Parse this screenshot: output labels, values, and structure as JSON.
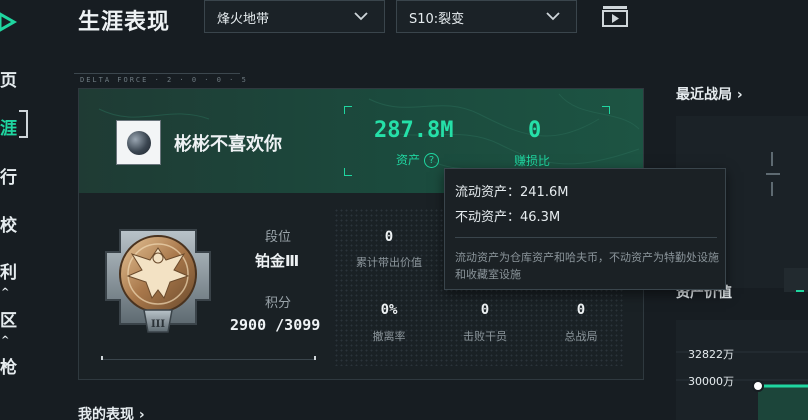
{
  "nav": {
    "items": [
      {
        "label": "页",
        "caret": ""
      },
      {
        "label": "涯",
        "caret": ""
      },
      {
        "label": "行",
        "caret": ""
      },
      {
        "label": "校",
        "caret": ""
      },
      {
        "label": "利",
        "caret": "^"
      },
      {
        "label": "区",
        "caret": "^"
      },
      {
        "label": "枪",
        "caret": ""
      }
    ],
    "active_index": 1
  },
  "header": {
    "title": "生涯表现",
    "map_select": "烽火地带",
    "season_select": "S10:裂变"
  },
  "profile": {
    "panel_label": "DELTA FORCE · 2 · 0 · 0 · 5",
    "username": "彬彬不喜欢你",
    "assets_value": "287.8M",
    "assets_label": "资产",
    "assets_help": "?",
    "profit_value": "0",
    "profit_label": "赚损比"
  },
  "rank": {
    "tier_label": "段位",
    "tier_value": "铂金Ⅲ",
    "score_label": "积分",
    "score_value": "2900 /3099",
    "badge_numeral": "III"
  },
  "stats": {
    "items": [
      {
        "value": "0",
        "label": "累计带出价值"
      },
      {
        "value": "0%",
        "label": "撤离率"
      },
      {
        "value": "0",
        "label": "击败干员"
      },
      {
        "value": "0",
        "label": "总战局"
      }
    ]
  },
  "tooltip": {
    "liquid": "流动资产：241.6M",
    "fixed": "不动资产：46.3M",
    "description": "流动资产为仓库资产和哈夫币，不动资产为特勤处设施和收藏室设施"
  },
  "right": {
    "recent_title": "最近战局",
    "asset_title": "资产价值",
    "tick_1": "32822万",
    "tick_2": "30000万",
    "chevron": "›"
  },
  "bottom": {
    "my_performance": "我的表现"
  },
  "colors": {
    "accent": "#1fd6a0",
    "background": "#171d22",
    "banner": "#1b4a3d"
  }
}
